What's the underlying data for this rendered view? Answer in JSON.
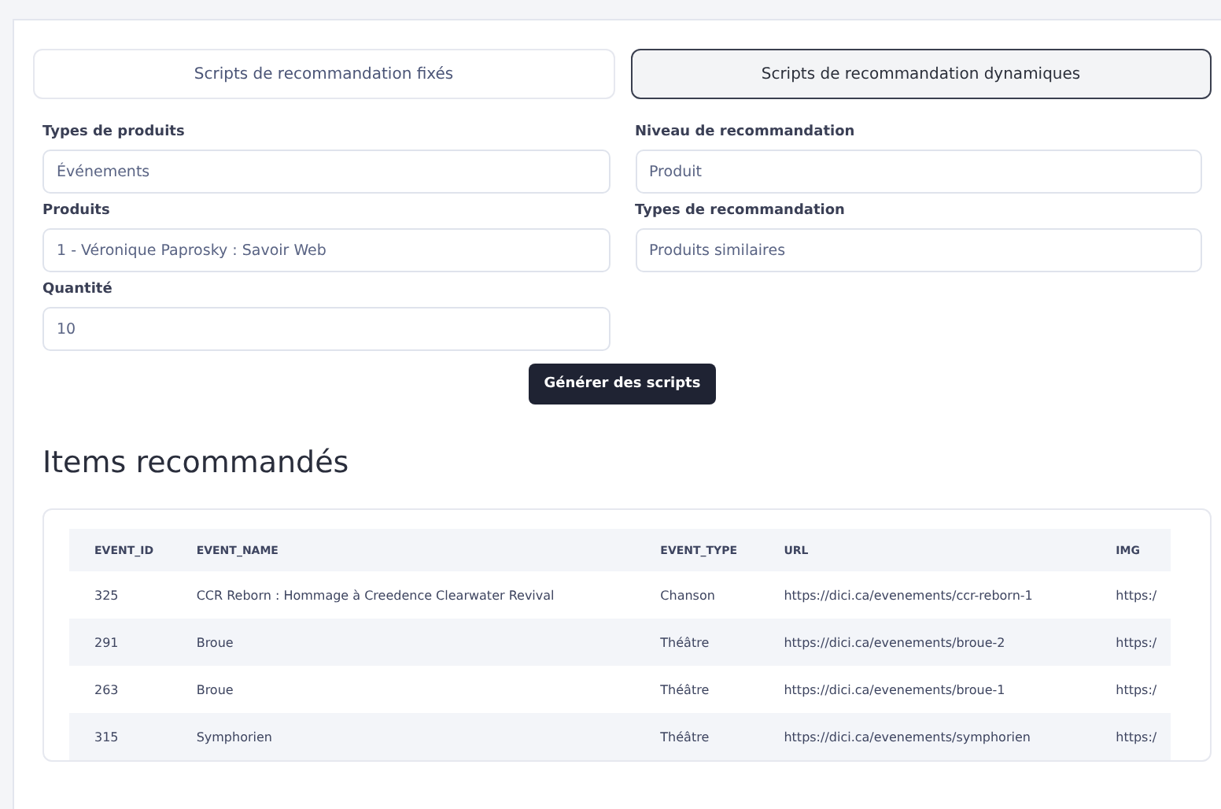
{
  "tabs": [
    {
      "label": "Scripts de recommandation fixés",
      "selected": false
    },
    {
      "label": "Scripts de recommandation dynamiques",
      "selected": true
    }
  ],
  "fields": [
    {
      "label": "Types de produits",
      "value": "Événements"
    },
    {
      "label": "Niveau de recommandation",
      "value": "Produit"
    },
    {
      "label": "Produits",
      "value": "1 - Véronique Paprosky : Savoir Web"
    },
    {
      "label": "Types de recommandation",
      "value": "Produits similaires"
    },
    {
      "label": "Quantité",
      "value": "10"
    }
  ],
  "generate_button": "Générer des scripts",
  "results_title": "Items recommandés",
  "table": {
    "columns": [
      "EVENT_ID",
      "EVENT_NAME",
      "EVENT_TYPE",
      "URL",
      "IMG"
    ],
    "rows": [
      [
        "325",
        "CCR Reborn : Hommage à Creedence Clearwater Revival",
        "Chanson",
        "https://dici.ca/evenements/ccr-reborn-1",
        "https:/"
      ],
      [
        "291",
        "Broue",
        "Théâtre",
        "https://dici.ca/evenements/broue-2",
        "https:/"
      ],
      [
        "263",
        "Broue",
        "Théâtre",
        "https://dici.ca/evenements/broue-1",
        "https:/"
      ],
      [
        "315",
        "Symphorien",
        "Théâtre",
        "https://dici.ca/evenements/symphorien",
        "https:/"
      ]
    ]
  }
}
